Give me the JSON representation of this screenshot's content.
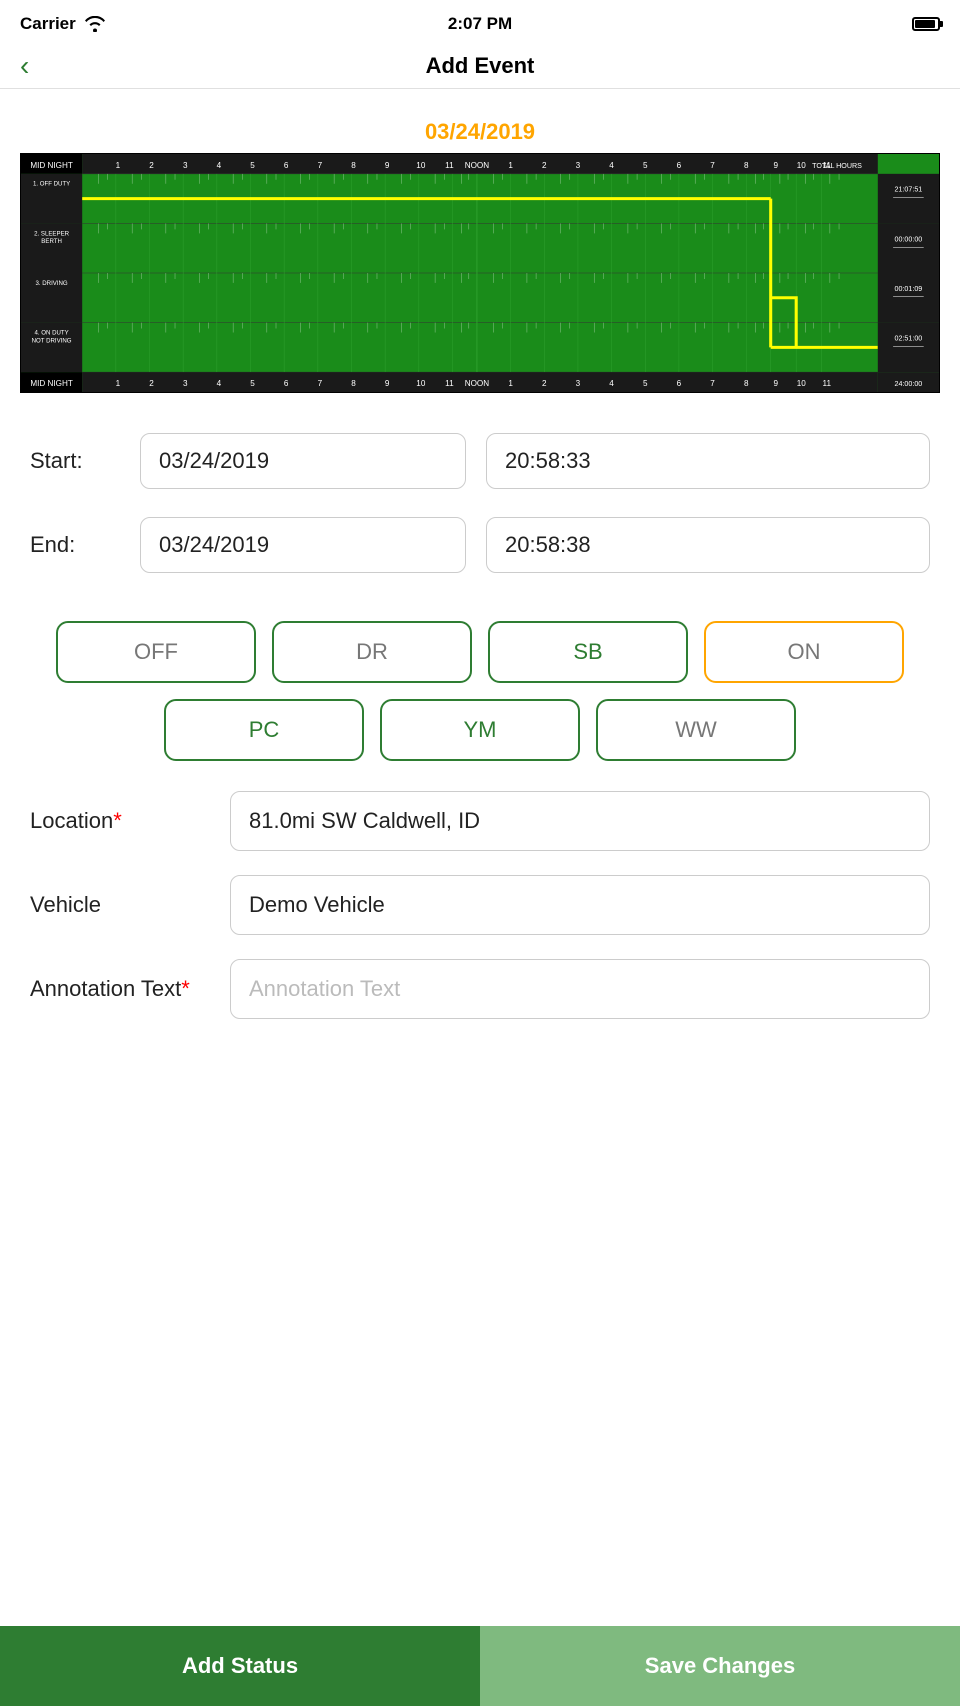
{
  "statusBar": {
    "carrier": "Carrier",
    "time": "2:07 PM",
    "wifiSymbol": "wifi"
  },
  "navBar": {
    "backLabel": "‹",
    "title": "Add Event"
  },
  "chart": {
    "date": "03/24/2019"
  },
  "form": {
    "startLabel": "Start:",
    "startDate": "03/24/2019",
    "startTime": "20:58:33",
    "endLabel": "End:",
    "endDate": "03/24/2019",
    "endTime": "20:58:38"
  },
  "statusButtons": {
    "row1": [
      {
        "id": "off",
        "label": "OFF",
        "style": "off"
      },
      {
        "id": "dr",
        "label": "DR",
        "style": "dr"
      },
      {
        "id": "sb",
        "label": "SB",
        "style": "sb"
      },
      {
        "id": "on",
        "label": "ON",
        "style": "on"
      }
    ],
    "row2": [
      {
        "id": "pc",
        "label": "PC",
        "style": "pc"
      },
      {
        "id": "ym",
        "label": "YM",
        "style": "ym"
      },
      {
        "id": "ww",
        "label": "WW",
        "style": "ww"
      }
    ]
  },
  "fields": {
    "locationLabel": "Location",
    "locationRequired": "*",
    "locationValue": "81.0mi SW Caldwell, ID",
    "vehicleLabel": "Vehicle",
    "vehicleValue": "Demo Vehicle",
    "annotationLabel": "Annotation Text",
    "annotationRequired": "*",
    "annotationPlaceholder": "Annotation Text"
  },
  "bottomBar": {
    "addStatus": "Add Status",
    "saveChanges": "Save Changes"
  }
}
